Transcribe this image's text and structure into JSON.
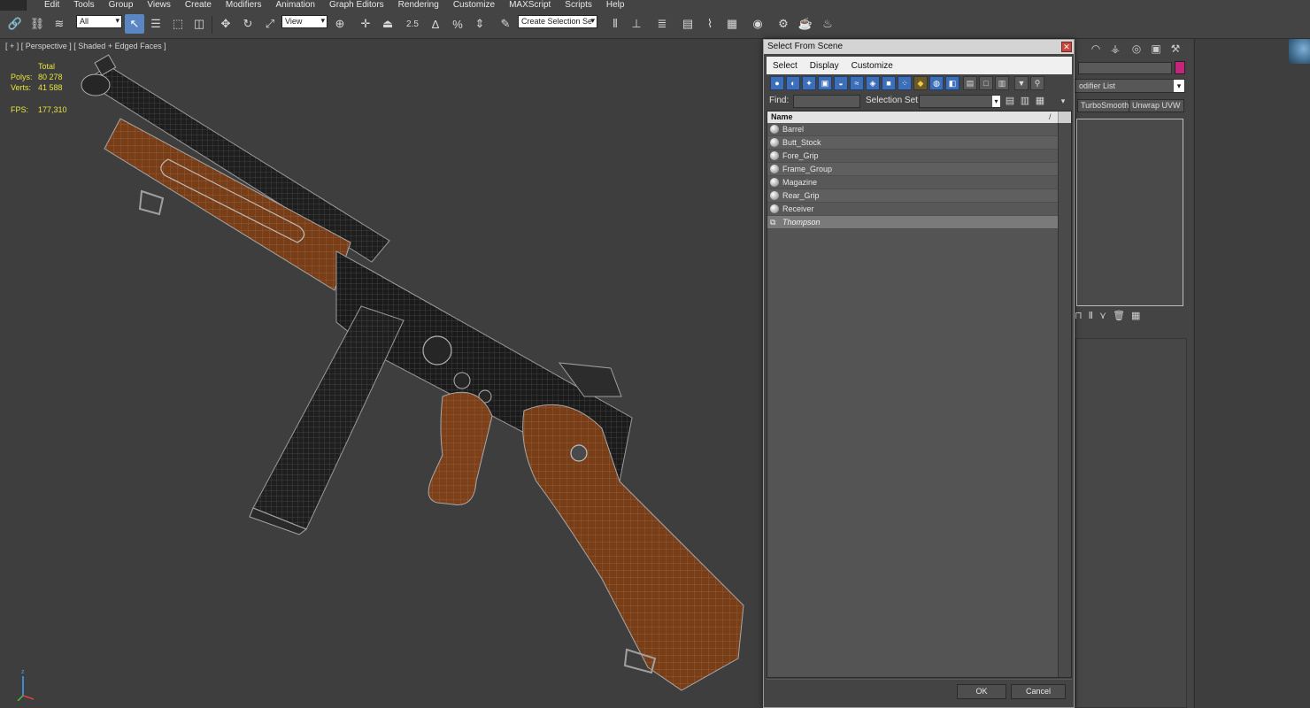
{
  "menubar": {
    "items": [
      "Edit",
      "Tools",
      "Group",
      "Views",
      "Create",
      "Modifiers",
      "Animation",
      "Graph Editors",
      "Rendering",
      "Customize",
      "MAXScript",
      "Scripts",
      "Help"
    ]
  },
  "toolbar": {
    "selection_filter": "All",
    "reference_coord": "View",
    "angle_snap_label": "2.5",
    "named_selection_placeholder": "Create Selection Se"
  },
  "viewport": {
    "label": "[ + ] [ Perspective ] [ Shaded + Edged Faces ]",
    "stats": {
      "total_label": "Total",
      "polys_label": "Polys:",
      "polys_value": "80 278",
      "verts_label": "Verts:",
      "verts_value": "41 588",
      "fps_label": "FPS:",
      "fps_value": "177,310"
    },
    "gizmo_axis_labels": {
      "z": "z",
      "x": "x",
      "y": "y"
    },
    "colors": {
      "wood": "#7a3e17",
      "metal": "#1c1c1c",
      "wire": "#9a9a9a",
      "stats_text": "#e8e23a"
    }
  },
  "dialog": {
    "title": "Select From Scene",
    "close_glyph": "✕",
    "menus": [
      "Select",
      "Display",
      "Customize"
    ],
    "find_label": "Find:",
    "find_value": "",
    "selection_set_label": "Selection Set:",
    "selection_set_value": "",
    "column_name": "Name",
    "column_sort_glyph": "/",
    "items": [
      {
        "name": "Barrel",
        "kind": "object"
      },
      {
        "name": "Butt_Stock",
        "kind": "object"
      },
      {
        "name": "Fore_Grip",
        "kind": "object"
      },
      {
        "name": "Frame_Group",
        "kind": "object"
      },
      {
        "name": "Magazine",
        "kind": "object"
      },
      {
        "name": "Rear_Grip",
        "kind": "object"
      },
      {
        "name": "Receiver",
        "kind": "object"
      },
      {
        "name": "Thompson",
        "kind": "group"
      }
    ],
    "ok_label": "OK",
    "cancel_label": "Cancel"
  },
  "command_panel": {
    "modifier_list_label": "odifier List",
    "modifier_buttons": [
      "TurboSmooth",
      "Unwrap UVW"
    ],
    "color_swatch": "#c2267a"
  }
}
